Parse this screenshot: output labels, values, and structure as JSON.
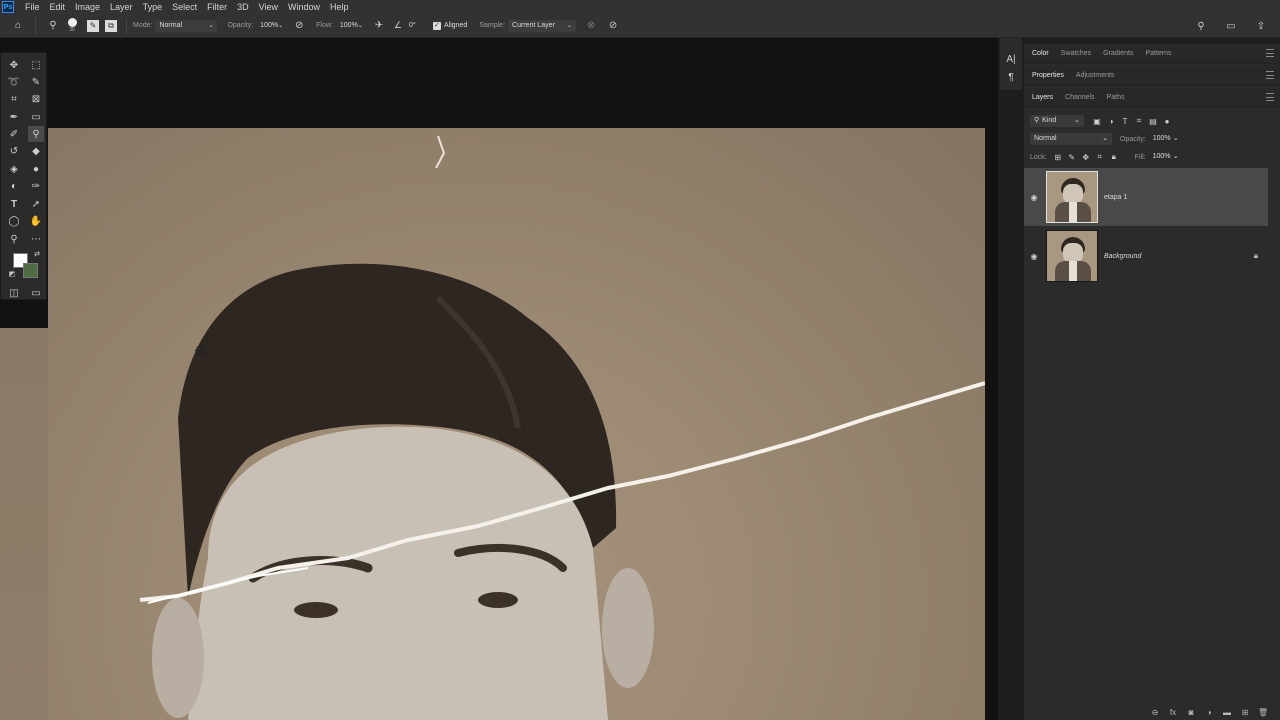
{
  "menu": {
    "items": [
      "File",
      "Edit",
      "Image",
      "Layer",
      "Type",
      "Select",
      "Filter",
      "3D",
      "View",
      "Window",
      "Help"
    ],
    "logo": "Ps"
  },
  "options": {
    "brush_size": "30",
    "mode_label": "Mode:",
    "mode_value": "Normal",
    "opacity_label": "Opacity:",
    "opacity_value": "100%",
    "flow_label": "Flow:",
    "flow_value": "100%",
    "angle_value": "0°",
    "aligned_label": "Aligned",
    "sample_label": "Sample:",
    "sample_value": "Current Layer"
  },
  "panels": {
    "top_tabs": [
      "Color",
      "Swatches",
      "Gradients",
      "Patterns"
    ],
    "mid_tabs": [
      "Properties",
      "Adjustments"
    ],
    "layer_tabs": [
      "Layers",
      "Channels",
      "Paths"
    ],
    "filter_kind": "Kind",
    "blend_mode": "Normal",
    "opacity_label": "Opacity:",
    "opacity_value": "100%",
    "lock_label": "Lock:",
    "fill_label": "Fill:",
    "fill_value": "100%"
  },
  "layers": [
    {
      "name": "etapa 1",
      "selected": true,
      "locked": false
    },
    {
      "name": "Background",
      "selected": false,
      "locked": true
    }
  ],
  "colors": {
    "foreground": "#ffffff",
    "background": "#4e6b42",
    "accent": "#31a8ff"
  }
}
